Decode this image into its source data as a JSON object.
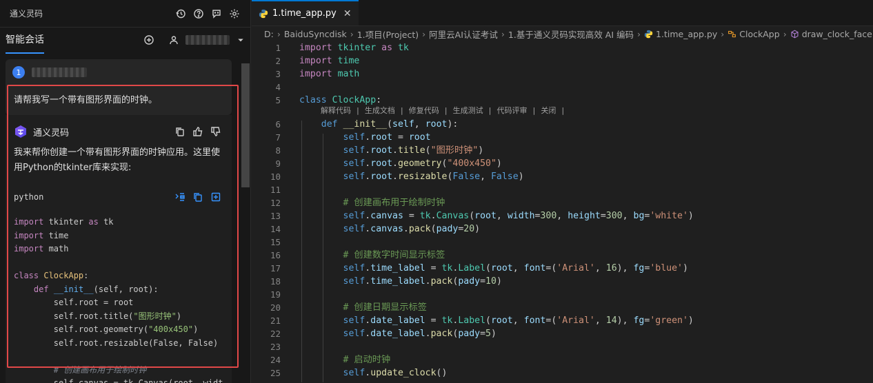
{
  "left_panel": {
    "title": "通义灵码",
    "tab_label": "智能会话",
    "message_number": "1",
    "user_question": "请帮我写一个带有图形界面的时钟。",
    "assistant_name": "通义灵码",
    "answer_text": "我来帮你创建一个带有图形界面的时钟应用。这里使用Python的tkinter库来实现:",
    "code_language": "python",
    "icons": [
      "history-icon",
      "help-icon",
      "chat-icon",
      "settings-icon",
      "add-icon",
      "user-icon",
      "chevron-down-icon",
      "copy-icon",
      "thumbs-up-icon",
      "thumbs-down-icon",
      "insert-icon",
      "new-file-icon"
    ]
  },
  "editor": {
    "tab_label": "1.time_app.py",
    "breadcrumbs": [
      "D:",
      "BaiduSyncdisk",
      "1.项目(Project)",
      "阿里云AI认证考试",
      "1.基于通义灵码实现高效 AI 编码",
      "1.time_app.py",
      "ClockApp",
      "draw_clock_face"
    ],
    "codelens": "解释代码 | 生成文档 | 修复代码 | 生成测试 | 代码评审 | 关闭 |",
    "line_numbers": [
      "1",
      "2",
      "3",
      "4",
      "5",
      "6",
      "7",
      "8",
      "9",
      "10",
      "11",
      "12",
      "13",
      "14",
      "15",
      "16",
      "17",
      "18",
      "19",
      "20",
      "21",
      "22",
      "23",
      "24",
      "25"
    ]
  },
  "colors": {
    "accent": "#0078d4",
    "highlight_border": "#e24848",
    "badge": "#3c7ff0"
  }
}
